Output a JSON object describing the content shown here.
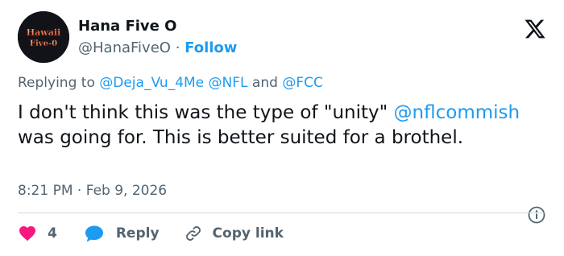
{
  "author": {
    "name": "Hana Five O",
    "handle": "@HanaFiveO",
    "separator": "·",
    "follow_label": "Follow",
    "avatar_text_line1": "Hawaii",
    "avatar_text_line2": "Five-0"
  },
  "reply_context": {
    "prefix": "Replying to",
    "mention1": "@Deja_Vu_4Me",
    "mention2": "@NFL",
    "conjunction": "and",
    "mention3": "@FCC"
  },
  "tweet": {
    "text_before": "I don't think this was the type of \"unity\"",
    "mention": "@nflcommish",
    "text_after": "was going for. This is better suited for a brothel."
  },
  "meta": {
    "time": "8:21 PM",
    "separator": "·",
    "date": "Feb 9, 2026"
  },
  "actions": {
    "like_count": "4",
    "reply_label": "Reply",
    "copy_label": "Copy link"
  },
  "colors": {
    "accent": "#1d9bf0",
    "like": "#f91880",
    "muted": "#536471",
    "text": "#0f1419",
    "divider": "#cfd9de"
  },
  "icons": [
    "x-logo-icon",
    "info-icon",
    "heart-icon",
    "reply-bubble-icon",
    "link-icon"
  ]
}
